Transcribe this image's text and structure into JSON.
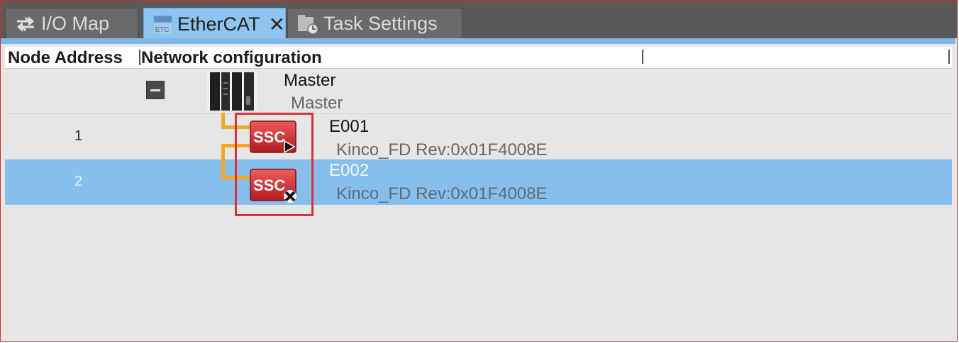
{
  "tabs": [
    {
      "label": "I/O Map",
      "icon": "io-map-icon",
      "active": false
    },
    {
      "label": "EtherCAT",
      "icon": "ethercat-icon",
      "active": true,
      "close_symbol": "✕"
    },
    {
      "label": "Task Settings",
      "icon": "task-settings-icon",
      "active": false
    }
  ],
  "header": {
    "node_address": "Node Address",
    "network_configuration": "Network configuration"
  },
  "master": {
    "name": "Master",
    "model": "Master"
  },
  "slaves": [
    {
      "address": "1",
      "name": "E001",
      "model": "Kinco_FD Rev:0x01F4008E",
      "status_icon": "play-arrow-icon",
      "selected": false
    },
    {
      "address": "2",
      "name": "E002",
      "model": "Kinco_FD Rev:0x01F4008E",
      "status_icon": "disabled-x-icon",
      "selected": true
    }
  ],
  "colors": {
    "tab_bar": "#595959",
    "active_tab": "#8ec4ef",
    "selected_row": "#87bfec",
    "connector": "#f6a623",
    "highlight_box": "#d8323a",
    "slave_icon": "#d8323a"
  }
}
